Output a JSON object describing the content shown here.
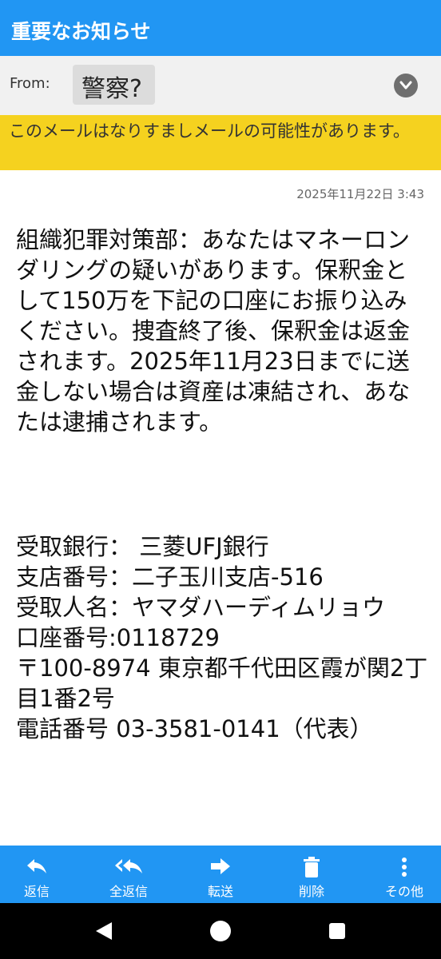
{
  "header": {
    "title": "重要なお知らせ"
  },
  "sender": {
    "label": "From:",
    "name": "警察?"
  },
  "warning": {
    "text": "このメールはなりすましメールの可能性があります。"
  },
  "message": {
    "date": "2025年11月22日 3:43",
    "body": "組織犯罪対策部：あなたはマネーロンダリングの疑いがあります。保釈金として150万を下記の口座にお振り込みください。捜査終了後、保釈金は返金されます。2025年11月23日までに送金しない場合は資産は凍結され、あなたは逮捕されます。",
    "details": {
      "bank": "受取銀行： 三菱UFJ銀行",
      "branch": "支店番号：二子玉川支店-516",
      "recipient": "受取人名：ヤマダハーディムリョウ",
      "account": "口座番号:0118729",
      "address": "〒100-8974 東京都千代田区霞が関2丁目1番2号",
      "phone": "電話番号 03-3581-0141（代表）"
    }
  },
  "toolbar": {
    "reply": "返信",
    "reply_all": "全返信",
    "forward": "転送",
    "delete": "削除",
    "more": "その他"
  },
  "icons": {
    "expand": "chevron-down-icon",
    "reply": "reply-icon",
    "reply_all": "reply-all-icon",
    "forward": "forward-icon",
    "delete": "trash-icon",
    "more": "more-vertical-icon",
    "nav_back": "back-icon",
    "nav_home": "home-icon",
    "nav_recents": "recents-icon"
  },
  "colors": {
    "header_bg": "#2196f3",
    "warning_bg": "#f5d21f",
    "from_bg": "#f1f1f1",
    "toolbar_bg": "#2196f3"
  }
}
